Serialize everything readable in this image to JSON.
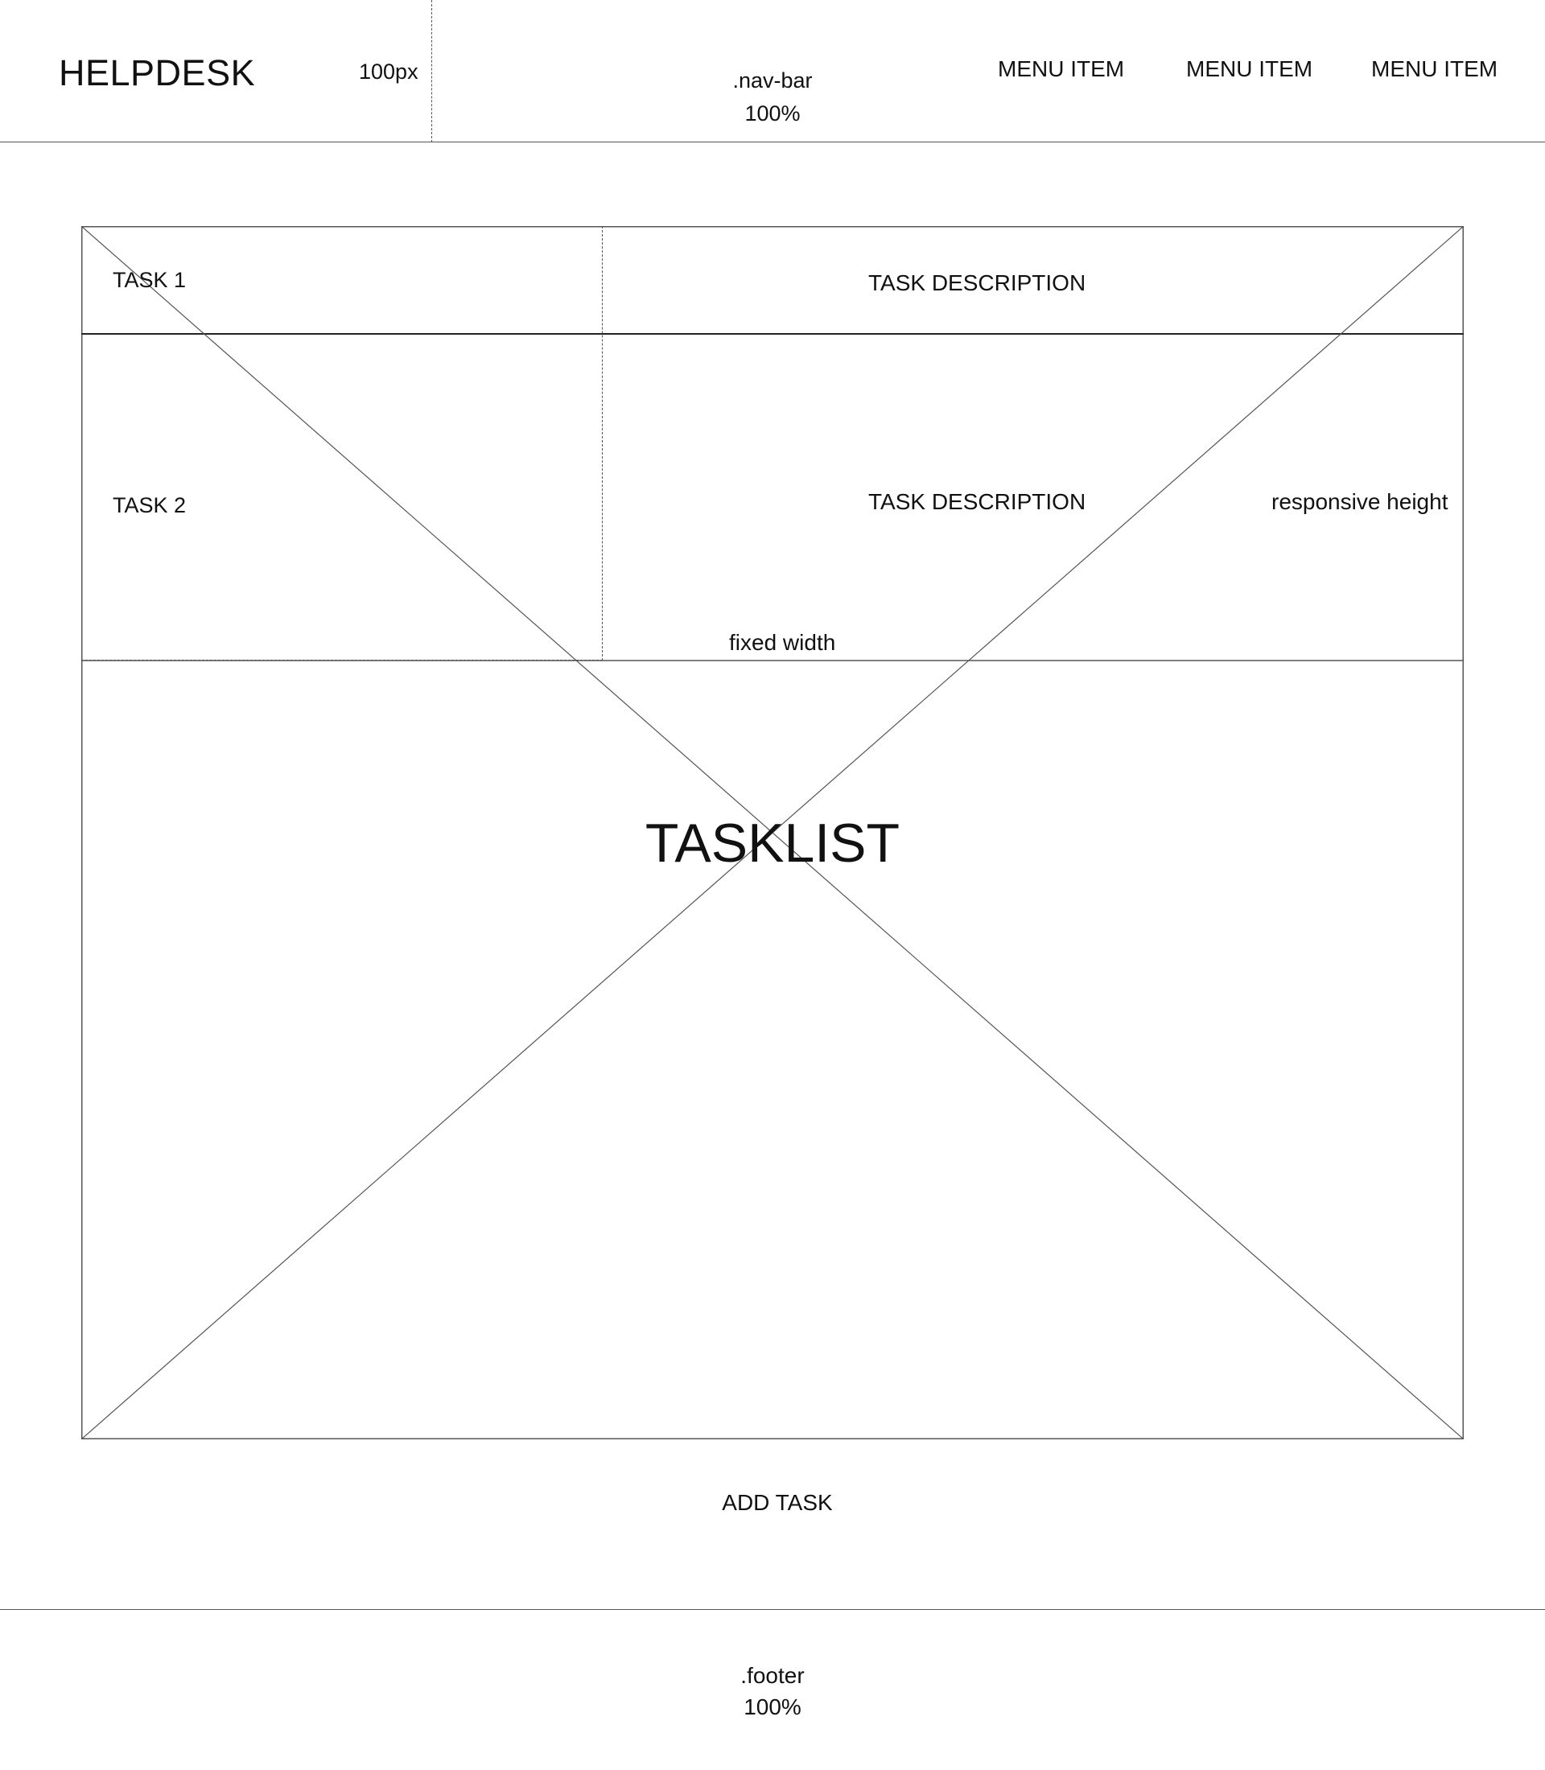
{
  "nav_bar": {
    "logo": "HELPDESK",
    "logo_width_note": "100px",
    "class_label": ".nav-bar",
    "width_label": "100%",
    "menu_items": [
      "MENU ITEM",
      "MENU ITEM",
      "MENU ITEM"
    ]
  },
  "tasklist": {
    "title": "TASKLIST",
    "tasks": [
      {
        "name": "TASK 1",
        "description": "TASK DESCRIPTION"
      },
      {
        "name": "TASK 2",
        "description": "TASK DESCRIPTION"
      }
    ],
    "notes": {
      "responsive": "responsive height",
      "fixed": "fixed width"
    }
  },
  "add_task_label": "ADD TASK",
  "footer": {
    "class_label": ".footer",
    "width_label": "100%"
  },
  "colors": {
    "line": "#555555",
    "text": "#111111",
    "background": "#ffffff"
  }
}
